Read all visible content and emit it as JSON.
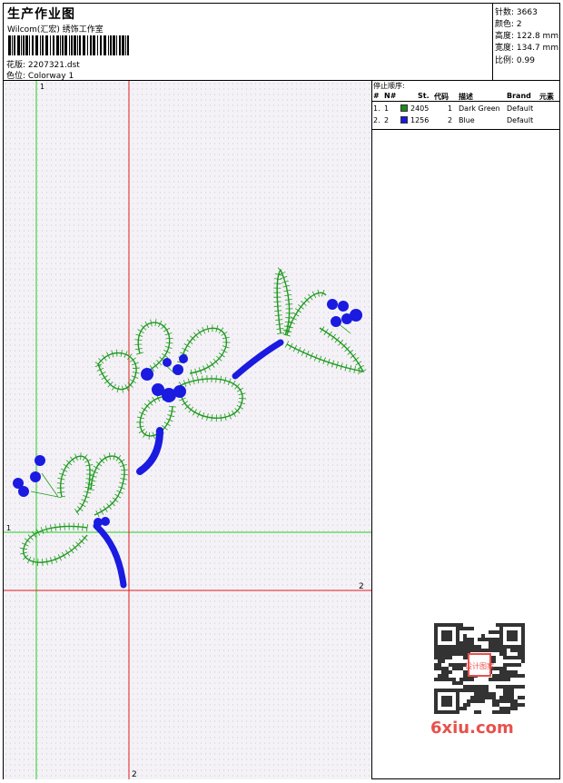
{
  "header": {
    "title": "生产作业图",
    "subtitle": "Wilcom(汇宏) 绣饰工作室",
    "design_label": "花版:",
    "design_value": "2207321.dst",
    "colorway_label": "色位:",
    "colorway_value": "Colorway 1"
  },
  "stats": [
    {
      "label": "针数:",
      "value": "3663"
    },
    {
      "label": "颜色:",
      "value": "2"
    },
    {
      "label": "高度:",
      "value": "122.8 mm"
    },
    {
      "label": "宽度:",
      "value": "134.7 mm"
    },
    {
      "label": "比例:",
      "value": "0.99"
    }
  ],
  "stop_sequence": {
    "label": "停止顺序:",
    "headers": [
      "#",
      "N#",
      "St.",
      "代码",
      "描述",
      "Brand",
      "元素"
    ],
    "rows": [
      {
        "num": "1.",
        "n": "1",
        "color": "#1e8a1e",
        "st": "2405",
        "code": "1",
        "desc": "Dark Green",
        "brand": "Default"
      },
      {
        "num": "2.",
        "n": "2",
        "color": "#1a1ae0",
        "st": "1256",
        "code": "2",
        "desc": "Blue",
        "brand": "Default"
      }
    ]
  },
  "axes": {
    "v1": "1",
    "h1": "1",
    "v2": "2",
    "h2": "2"
  },
  "colors": {
    "green_thread": "#1e9a1e",
    "blue_thread": "#1a1ae0",
    "green_guide": "#22cc22",
    "red_guide": "#e02020"
  },
  "watermark": {
    "text": "6xiu.com",
    "stamp": "设计图案"
  }
}
